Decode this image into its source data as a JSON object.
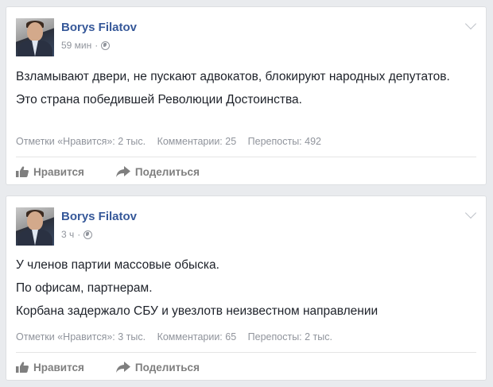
{
  "posts": [
    {
      "author": "Borys Filatov",
      "time": "59 мин",
      "separator": "·",
      "text": [
        "Взламывают двери, не пускают адвокатов, блокируют народных депутатов.",
        "Это страна победившей Революции Достоинства."
      ],
      "stats": {
        "likes": "Отметки «Нравится»: 2 тыс.",
        "comments": "Комментарии: 25",
        "shares": "Перепосты: 492"
      },
      "actions": {
        "like": "Нравится",
        "share": "Поделиться"
      }
    },
    {
      "author": "Borys Filatov",
      "time": "3 ч",
      "separator": "·",
      "text": [
        "У членов партии массовые обыска.",
        "По офисам, партнерам.",
        "Корбана задержало СБУ и увезлотв неизвестном направлении"
      ],
      "stats": {
        "likes": "Отметки «Нравится»: 3 тыс.",
        "comments": "Комментарии: 65",
        "shares": "Перепосты: 2 тыс."
      },
      "actions": {
        "like": "Нравится",
        "share": "Поделиться"
      }
    }
  ],
  "colors": {
    "background": "#e9ebee",
    "author_link": "#365899",
    "meta_gray": "#90949c",
    "action_gray": "#7f7f7f"
  },
  "icons": {
    "avatar": "profile-photo",
    "privacy": "globe-icon",
    "menu": "chevron-down-icon",
    "like": "thumbs-up-icon",
    "share": "share-arrow-icon"
  }
}
